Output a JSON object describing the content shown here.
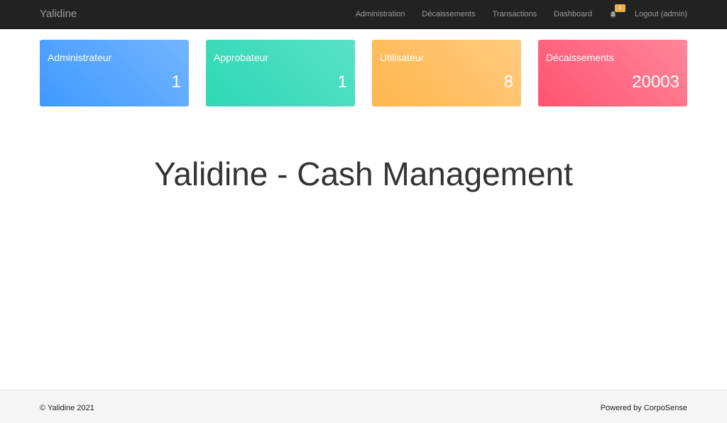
{
  "navbar": {
    "brand": "Yalidine",
    "links": [
      "Administration",
      "Décaissements",
      "Transactions",
      "Dashboard"
    ],
    "notification_count": "1",
    "logout": "Logout (admin)"
  },
  "cards": [
    {
      "label": "Administrateur",
      "count": "1",
      "color": "#4099ff"
    },
    {
      "label": "Approbateur",
      "count": "1",
      "color": "#2ed8b6"
    },
    {
      "label": "Utilisateur",
      "count": "8",
      "color": "#ffb64d"
    },
    {
      "label": "Décaissements",
      "count": "20003",
      "color": "#ff5370"
    }
  ],
  "hero": {
    "title": "Yalidine - Cash Management"
  },
  "footer": {
    "copyright": "© Yalidine 2021",
    "powered": "Powered by CorpoSense"
  }
}
